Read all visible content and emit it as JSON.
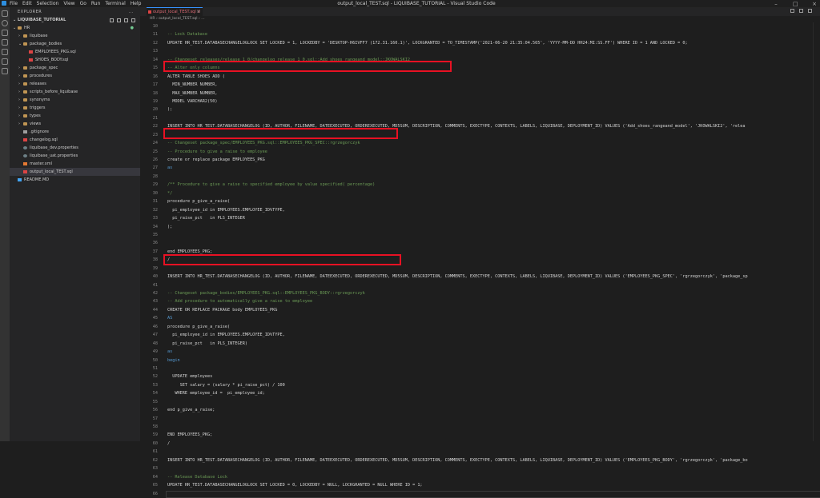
{
  "window": {
    "title": "output_local_TEST.sql - LIQUIBASE_TUTORIAL - Visual Studio Code",
    "menu": [
      "File",
      "Edit",
      "Selection",
      "View",
      "Go",
      "Run",
      "Terminal",
      "Help"
    ]
  },
  "sidebar": {
    "header": "EXPLORER",
    "header_more": "...",
    "project": "LIQUIBASE_TUTORIAL",
    "items": [
      {
        "label": "HR",
        "type": "folder",
        "depth": 1,
        "open": true,
        "modified": "●"
      },
      {
        "label": "liquibase",
        "type": "folder",
        "depth": 2,
        "open": false
      },
      {
        "label": "package_bodies",
        "type": "folder",
        "depth": 2,
        "open": true
      },
      {
        "label": "EMPLOYEES_PKG.sql",
        "type": "sql",
        "depth": 3
      },
      {
        "label": "SHOES_BODY.sql",
        "type": "sql",
        "depth": 3
      },
      {
        "label": "package_spec",
        "type": "folder",
        "depth": 2,
        "open": false
      },
      {
        "label": "procedures",
        "type": "folder",
        "depth": 2,
        "open": false
      },
      {
        "label": "releases",
        "type": "folder",
        "depth": 2,
        "open": false
      },
      {
        "label": "scripts_before_liquibase",
        "type": "folder",
        "depth": 2,
        "open": false
      },
      {
        "label": "synonyms",
        "type": "folder",
        "depth": 2,
        "open": false
      },
      {
        "label": "triggers",
        "type": "folder",
        "depth": 2,
        "open": false
      },
      {
        "label": "types",
        "type": "folder",
        "depth": 2,
        "open": false
      },
      {
        "label": "views",
        "type": "folder",
        "depth": 2,
        "open": false
      },
      {
        "label": ".gitignore",
        "type": "file",
        "depth": 2
      },
      {
        "label": "changelog.sql",
        "type": "sql",
        "depth": 2
      },
      {
        "label": "liquibase_dev.properties",
        "type": "gear",
        "depth": 2
      },
      {
        "label": "liquibase_uat.properties",
        "type": "gear",
        "depth": 2
      },
      {
        "label": "master.xml",
        "type": "xml",
        "depth": 2
      },
      {
        "label": "output_local_TEST.sql",
        "type": "sql",
        "depth": 2,
        "selected": true
      },
      {
        "label": "README.MD",
        "type": "readme",
        "depth": 1
      }
    ]
  },
  "tab": {
    "label": "output_local_TEST.sql U"
  },
  "breadcrumb": "HR › output_local_TEST.sql › ...",
  "code_lines": [
    {
      "n": "10",
      "t": ""
    },
    {
      "n": "11",
      "t": "-- Lock Database",
      "c": "cm"
    },
    {
      "n": "12",
      "t": "UPDATE HR_TEST.DATABASECHANGELOGLOCK SET LOCKED = 1, LOCKEDBY = 'DESKTOP-H6IVFF7 (172.31.160.1)', LOCKGRANTED = TO_TIMESTAMP('2021-06-20 21:35:04.565', 'YYYY-MM-DD HH24:MI:SS.FF') WHERE ID = 1 AND LOCKED = 0;",
      "c": "plain"
    },
    {
      "n": "13",
      "t": ""
    },
    {
      "n": "14",
      "t": "-- Changeset releases/release_1_0/changelog_release_1_0.sql::Add_shoes_rangeand_model::JKOWALSKI2",
      "c": "cm"
    },
    {
      "n": "15",
      "t": "-- Alter only columns",
      "c": "cm"
    },
    {
      "n": "16",
      "t": "ALTER TABLE SHOES ADD (",
      "c": "plain"
    },
    {
      "n": "17",
      "t": "  MIN_NUMBER NUMBER,",
      "c": "plain"
    },
    {
      "n": "18",
      "t": "  MAX_NUMBER NUMBER,",
      "c": "plain"
    },
    {
      "n": "19",
      "t": "  MODEL VARCHAR2(50)",
      "c": "plain"
    },
    {
      "n": "20",
      "t": ");",
      "c": "plain"
    },
    {
      "n": "21",
      "t": ""
    },
    {
      "n": "22",
      "t": "INSERT INTO HR_TEST.DATABASECHANGELOG (ID, AUTHOR, FILENAME, DATEEXECUTED, ORDEREXECUTED, MD5SUM, DESCRIPTION, COMMENTS, EXECTYPE, CONTEXTS, LABELS, LIQUIBASE, DEPLOYMENT_ID) VALUES ('Add_shoes_rangeand_model', 'JKOWALSKI2', 'relea",
      "c": "plain"
    },
    {
      "n": "23",
      "t": ""
    },
    {
      "n": "24",
      "t": "-- Changeset package_spec/EMPLOYEES_PKG.sql::EMPLOYEES_PKG_SPEC::rgrzegorczyk",
      "c": "cm"
    },
    {
      "n": "25",
      "t": "-- Procedure to give a raise to employee",
      "c": "cm"
    },
    {
      "n": "26",
      "t": "create or replace package EMPLOYEES_PKG",
      "c": "plain"
    },
    {
      "n": "27",
      "t": "as",
      "c": "kw"
    },
    {
      "n": "28",
      "t": ""
    },
    {
      "n": "29",
      "t": "/** Procedure to give a raise to specified employee by value specified( percentage)",
      "c": "cm"
    },
    {
      "n": "30",
      "t": "*/",
      "c": "cm"
    },
    {
      "n": "31",
      "t": "procedure p_give_a_raise(",
      "c": "plain"
    },
    {
      "n": "32",
      "t": "  pi_employee_id in EMPLOYEES.EMPLOYEE_ID%TYPE,",
      "c": "plain"
    },
    {
      "n": "33",
      "t": "  pi_raise_pct   in PLS_INTEGER",
      "c": "plain"
    },
    {
      "n": "34",
      "t": ");",
      "c": "plain"
    },
    {
      "n": "35",
      "t": ""
    },
    {
      "n": "36",
      "t": ""
    },
    {
      "n": "37",
      "t": "end EMPLOYEES_PKG;",
      "c": "plain"
    },
    {
      "n": "38",
      "t": "/",
      "c": "plain"
    },
    {
      "n": "39",
      "t": ""
    },
    {
      "n": "40",
      "t": "INSERT INTO HR_TEST.DATABASECHANGELOG (ID, AUTHOR, FILENAME, DATEEXECUTED, ORDEREXECUTED, MD5SUM, DESCRIPTION, COMMENTS, EXECTYPE, CONTEXTS, LABELS, LIQUIBASE, DEPLOYMENT_ID) VALUES ('EMPLOYEES_PKG_SPEC', 'rgrzegorczyk', 'package_sp",
      "c": "plain"
    },
    {
      "n": "41",
      "t": ""
    },
    {
      "n": "42",
      "t": "-- Changeset package_bodies/EMPLOYEES_PKG.sql::EMPLOYEES_PKG_BODY::rgrzegorczyk",
      "c": "cm"
    },
    {
      "n": "43",
      "t": "-- Add procedure to automatically give a raise to employee",
      "c": "cm"
    },
    {
      "n": "44",
      "t": "CREATE OR REPLACE PACKAGE body EMPLOYEES_PKG",
      "c": "plain"
    },
    {
      "n": "45",
      "t": "AS",
      "c": "kw"
    },
    {
      "n": "46",
      "t": "procedure p_give_a_raise(",
      "c": "plain"
    },
    {
      "n": "47",
      "t": "  pi_employee_id in EMPLOYEES.EMPLOYEE_ID%TYPE,",
      "c": "plain"
    },
    {
      "n": "48",
      "t": "  pi_raise_pct   in PLS_INTEGER)",
      "c": "plain"
    },
    {
      "n": "49",
      "t": "as",
      "c": "kw"
    },
    {
      "n": "50",
      "t": "begin",
      "c": "kw"
    },
    {
      "n": "51",
      "t": ""
    },
    {
      "n": "52",
      "t": "  UPDATE employees",
      "c": "plain"
    },
    {
      "n": "53",
      "t": "     SET salary = (salary * pi_raise_pct) / 100",
      "c": "plain"
    },
    {
      "n": "54",
      "t": "   WHERE employee_id =  pi_employee_id;",
      "c": "plain"
    },
    {
      "n": "55",
      "t": ""
    },
    {
      "n": "56",
      "t": "end p_give_a_raise;",
      "c": "plain"
    },
    {
      "n": "57",
      "t": ""
    },
    {
      "n": "58",
      "t": ""
    },
    {
      "n": "59",
      "t": "END EMPLOYEES_PKG;",
      "c": "plain"
    },
    {
      "n": "60",
      "t": "/",
      "c": "plain"
    },
    {
      "n": "61",
      "t": ""
    },
    {
      "n": "62",
      "t": "INSERT INTO HR_TEST.DATABASECHANGELOG (ID, AUTHOR, FILENAME, DATEEXECUTED, ORDEREXECUTED, MD5SUM, DESCRIPTION, COMMENTS, EXECTYPE, CONTEXTS, LABELS, LIQUIBASE, DEPLOYMENT_ID) VALUES ('EMPLOYEES_PKG_BODY', 'rgrzegorczyk', 'package_bo",
      "c": "plain"
    },
    {
      "n": "63",
      "t": ""
    },
    {
      "n": "64",
      "t": "-- Release Database Lock",
      "c": "cm"
    },
    {
      "n": "65",
      "t": "UPDATE HR_TEST.DATABASECHANGELOGLOCK SET LOCKED = 0, LOCKEDBY = NULL, LOCKGRANTED = NULL WHERE ID = 1;",
      "c": "plain"
    },
    {
      "n": "66",
      "t": "",
      "current": true
    }
  ],
  "colors": {
    "highlight_box": "#e81123",
    "tab_accent": "#3794ff",
    "comment": "#6a9955",
    "keyword": "#569cd6"
  }
}
